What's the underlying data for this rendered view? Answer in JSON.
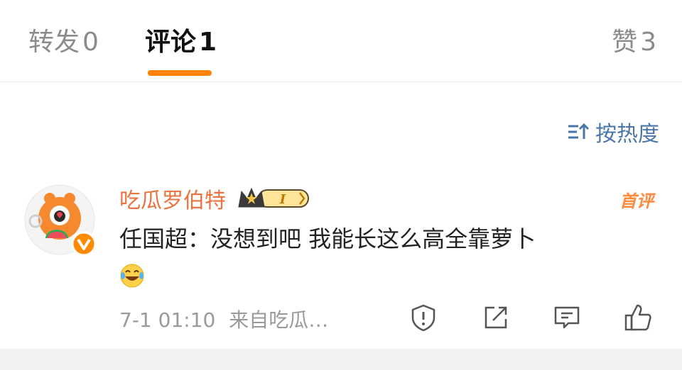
{
  "tabs": {
    "repost": {
      "label": "转发",
      "count": "0"
    },
    "comment": {
      "label": "评论",
      "count": "1"
    },
    "likes": {
      "label": "赞",
      "count": "3"
    }
  },
  "sort": {
    "label": "按热度",
    "icon": "sort-icon"
  },
  "comment": {
    "username": "吃瓜罗伯特",
    "level_badge": "I",
    "first_tag": "首评",
    "text": "任国超：没想到吧 我能长这么高全靠萝卜",
    "emoji": "laughing-tears-emoji",
    "time": "7-1 01:10",
    "source": "来自吃瓜…",
    "actions": [
      "report-icon",
      "share-icon",
      "reply-icon",
      "like-icon"
    ]
  },
  "colors": {
    "accent": "#ff8200",
    "username": "#eb7340",
    "link": "#4a76a8",
    "muted": "#9a9a9a"
  }
}
